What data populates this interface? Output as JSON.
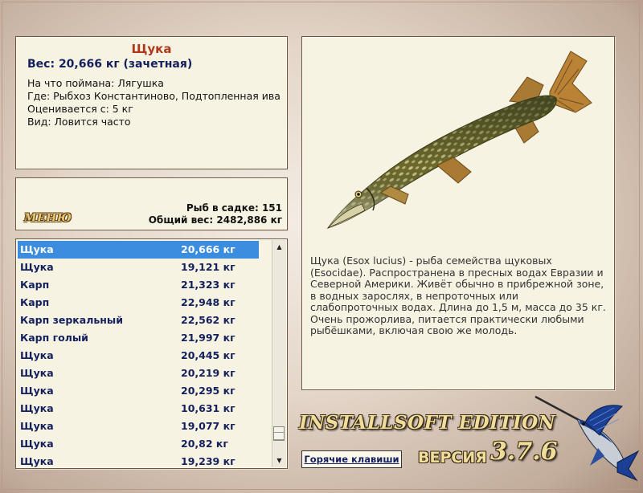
{
  "info": {
    "title": "Щука",
    "weight": "Вес: 20,666 кг (зачетная)",
    "caught_with": "На что поймана: Лягушка",
    "location": "Где: Рыбхоз Константиново, Подтопленная ива",
    "rated_from": "Оценивается с: 5 кг",
    "kind": "Вид: Ловится часто"
  },
  "menu_label": "МЕНЮ",
  "stats": {
    "fish_in_keepnet": "Рыб в садке: 151",
    "total_weight": "Общий вес: 2482,886 кг"
  },
  "catch_list": [
    {
      "name": "Щука",
      "weight": "20,666 кг",
      "selected": true
    },
    {
      "name": "Щука",
      "weight": "19,121 кг"
    },
    {
      "name": "Карп",
      "weight": "21,323 кг"
    },
    {
      "name": "Карп",
      "weight": "22,948 кг"
    },
    {
      "name": "Карп зеркальный",
      "weight": "22,562 кг"
    },
    {
      "name": "Карп голый",
      "weight": "21,997 кг"
    },
    {
      "name": "Щука",
      "weight": "20,445 кг"
    },
    {
      "name": "Щука",
      "weight": "20,219 кг"
    },
    {
      "name": "Щука",
      "weight": "20,295 кг"
    },
    {
      "name": "Щука",
      "weight": "10,631 кг"
    },
    {
      "name": "Щука",
      "weight": "19,077 кг"
    },
    {
      "name": "Щука",
      "weight": "20,82 кг"
    },
    {
      "name": "Щука",
      "weight": "19,239 кг"
    }
  ],
  "scrollbar": {
    "up_icon": "arrow-up-icon",
    "down_icon": "arrow-down-icon"
  },
  "description": "Щука (Esox lucius) - рыба семейства щуковых (Esocidae). Распространена в пресных водах Евразии и Северной Америки. Живёт обычно в прибрежной зоне, в водных зарослях, в непроточных или слабопроточных водах. Длина до 1,5 м, масса до 35 кг. Очень прожорлива, питается практически любыми рыбёшками, включая свою же молодь.",
  "brand": {
    "edition": "INSTALLSOFT EDITION",
    "version_label": "ВЕРСИЯ",
    "version": "3.7.6"
  },
  "hotkeys_label": "Горячие клавиши",
  "colors": {
    "accent_title": "#b0361c",
    "text_navy": "#14205e",
    "selection": "#3c8de0",
    "panel_bg": "#f6f3e2"
  }
}
